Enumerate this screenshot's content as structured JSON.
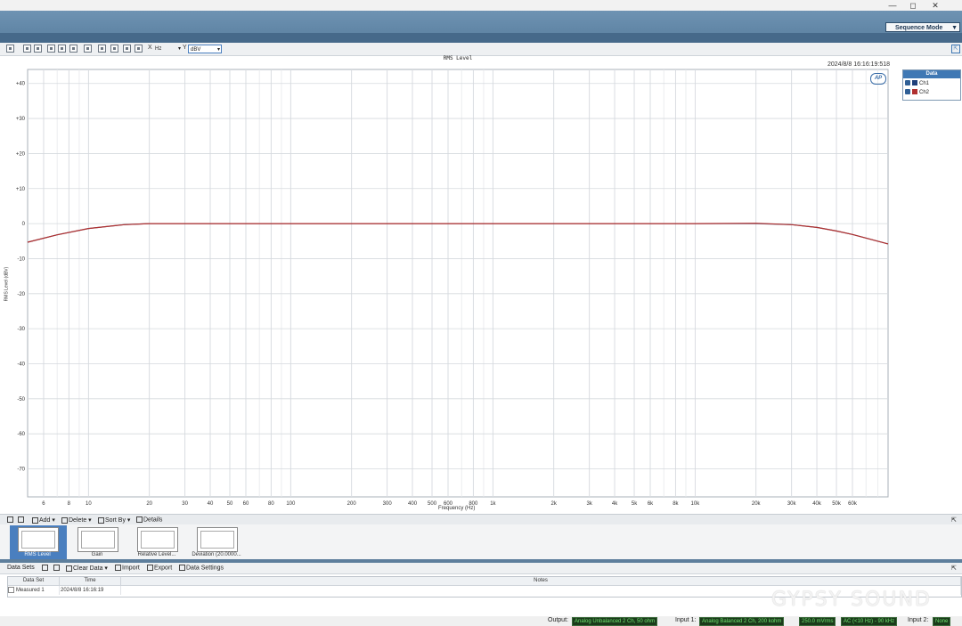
{
  "window": {
    "minimize": "—",
    "restore": "◻",
    "close": "✕"
  },
  "header": {
    "sequence_mode": "Sequence Mode"
  },
  "graph_toolbar": {
    "x_label": "X",
    "x_unit": "Hz",
    "y_label": "Y",
    "y_unit": "dBV"
  },
  "graph": {
    "title": "RMS Level",
    "timestamp": "2024/8/8 16:16:19:518",
    "logo": "AP",
    "x_axis_label": "Frequency (Hz)",
    "y_axis_label": "RMS Level (dBV)",
    "legend": {
      "title": "Data",
      "items": [
        {
          "label": "Ch1",
          "color": "#1f3f7a"
        },
        {
          "label": "Ch2",
          "color": "#b03030"
        }
      ]
    }
  },
  "chart_data": {
    "type": "line",
    "x_scale": "log",
    "xlim": [
      5,
      90000
    ],
    "ylim": [
      -78,
      44
    ],
    "grid": true,
    "legend_position": "top-right",
    "title": "RMS Level",
    "xlabel": "Frequency (Hz)",
    "ylabel": "RMS Level (dBV)",
    "y_ticks": [
      40,
      30,
      20,
      10,
      0,
      -10,
      -20,
      -30,
      -40,
      -50,
      -60,
      -70
    ],
    "y_tick_labels": [
      "+40",
      "+30",
      "+20",
      "+10",
      "0",
      "-10",
      "-20",
      "-30",
      "-40",
      "-50",
      "-60",
      "-70"
    ],
    "x_ticks": [
      6,
      8,
      10,
      20,
      30,
      40,
      50,
      60,
      80,
      100,
      200,
      300,
      400,
      500,
      600,
      800,
      1000,
      2000,
      3000,
      4000,
      5000,
      6000,
      8000,
      10000,
      20000,
      30000,
      40000,
      50000,
      60000
    ],
    "x_tick_labels": [
      "6",
      "8",
      "10",
      "20",
      "30",
      "40",
      "50",
      "60",
      "80",
      "100",
      "200",
      "300",
      "400",
      "500",
      "600",
      "800",
      "1k",
      "2k",
      "3k",
      "4k",
      "5k",
      "6k",
      "8k",
      "10k",
      "20k",
      "30k",
      "40k",
      "50k",
      "60k"
    ],
    "series": [
      {
        "name": "Ch1",
        "color": "#6a6f8a",
        "x": [
          5,
          7,
          10,
          15,
          20,
          50,
          100,
          1000,
          10000,
          20000,
          30000,
          40000,
          50000,
          60000,
          90000
        ],
        "y": [
          -5.3,
          -3.2,
          -1.4,
          -0.3,
          0,
          0,
          0,
          0,
          0,
          0,
          -0.3,
          -1.1,
          -2.1,
          -3.1,
          -5.8
        ]
      },
      {
        "name": "Ch2",
        "color": "#b03030",
        "x": [
          5,
          7,
          10,
          15,
          20,
          50,
          100,
          1000,
          10000,
          20000,
          30000,
          40000,
          50000,
          60000,
          90000
        ],
        "y": [
          -5.3,
          -3.2,
          -1.4,
          -0.3,
          0,
          0,
          0,
          0,
          0,
          0.1,
          -0.3,
          -1.1,
          -2.1,
          -3.1,
          -5.8
        ]
      }
    ]
  },
  "nav_toolbar": {
    "add": "Add",
    "delete": "Delete",
    "sort_by": "Sort By",
    "details": "Details"
  },
  "thumbnails": [
    {
      "label": "RMS Level"
    },
    {
      "label": "Gain"
    },
    {
      "label": "Relative Level..."
    },
    {
      "label": "Deviation (20.0000..."
    }
  ],
  "data_sets_toolbar": {
    "title": "Data Sets",
    "clear_data": "Clear Data",
    "import": "Import",
    "export": "Export",
    "data_settings": "Data Settings"
  },
  "data_table": {
    "headers": [
      "Data Set",
      "Time",
      "Notes"
    ],
    "rows": [
      {
        "data_set": "Measured 1",
        "time": "2024/8/8 16:16:19",
        "notes": ""
      }
    ]
  },
  "watermark": "GYPSY SOUND",
  "status_bar": {
    "output_label": "Output:",
    "output_value": "Analog Unbalanced 2 Ch, 50 ohm",
    "input1_label": "Input 1:",
    "input1_value": "Analog Balanced 2 Ch, 200 kohm",
    "input1_level": "250.0 mVrms",
    "input1_filter": "AC (<10 Hz) - 90 kHz",
    "input2_label": "Input 2:",
    "input2_value": "None"
  }
}
